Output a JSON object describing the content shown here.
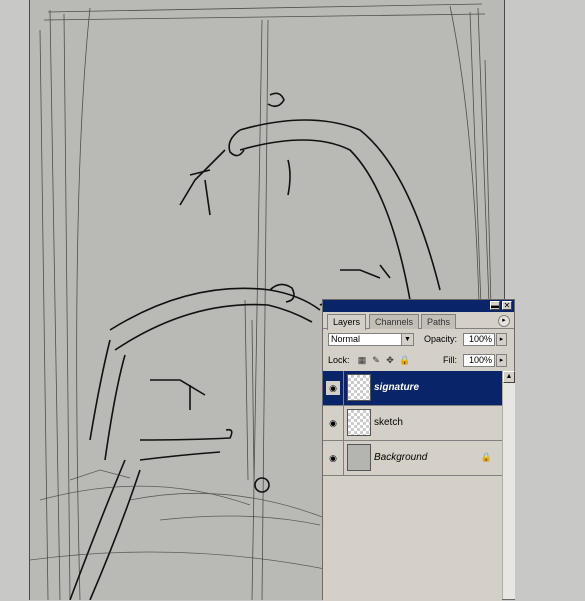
{
  "panel": {
    "tabs": [
      {
        "label": "Layers",
        "active": true
      },
      {
        "label": "Channels",
        "active": false
      },
      {
        "label": "Paths",
        "active": false
      }
    ],
    "menu_icon": "palette-menu-arrow-icon",
    "blend_mode": "Normal",
    "opacity_label": "Opacity:",
    "opacity_value": "100%",
    "lock_label": "Lock:",
    "fill_label": "Fill:",
    "fill_value": "100%",
    "lock_icons": [
      "lock-transparency-icon",
      "lock-paint-icon",
      "lock-move-icon",
      "lock-all-icon"
    ],
    "layers": [
      {
        "name": "signature",
        "selected": true,
        "visible": true,
        "thumb": "transparent"
      },
      {
        "name": "sketch",
        "selected": false,
        "visible": true,
        "thumb": "transparent"
      },
      {
        "name": "Background",
        "selected": false,
        "visible": true,
        "thumb": "solid",
        "locked": true
      }
    ]
  },
  "colors": {
    "selection": "#0a246a",
    "panel_bg": "#d4d0c8",
    "canvas_bg": "#b9b9b5"
  }
}
